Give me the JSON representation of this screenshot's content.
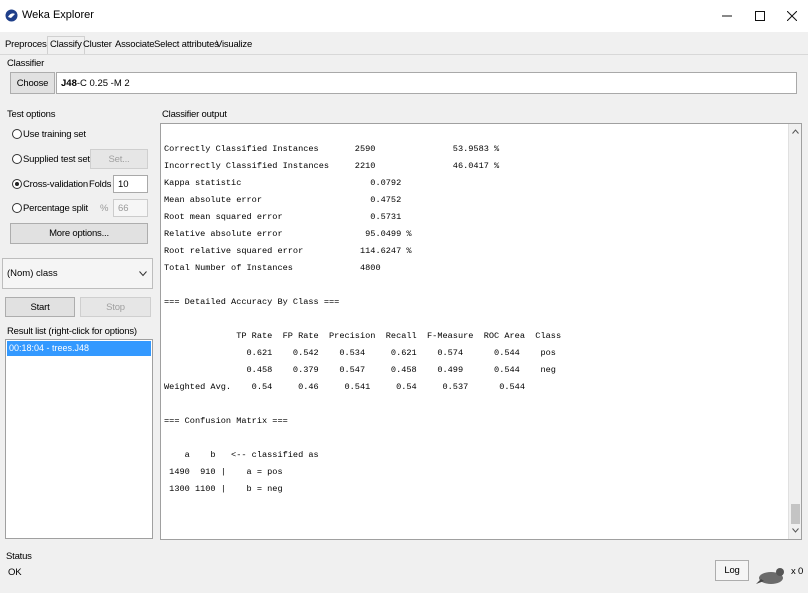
{
  "window": {
    "title": "Weka Explorer"
  },
  "tabs": [
    "Preprocess",
    "Classify",
    "Cluster",
    "Associate",
    "Select attributes",
    "Visualize"
  ],
  "classifier": {
    "section_label": "Classifier",
    "choose_label": "Choose",
    "name": "J48",
    "options": " -C 0.25 -M 2"
  },
  "test_options": {
    "section_label": "Test options",
    "use_training": "Use training set",
    "supplied_test": "Supplied test set",
    "set_button": "Set...",
    "cross_validation": "Cross-validation",
    "folds_label": "Folds",
    "folds_value": "10",
    "percentage_split": "Percentage split",
    "percent_symbol": "%",
    "percent_value": "66",
    "more_options": "More options..."
  },
  "class_select": {
    "value": "(Nom) class"
  },
  "actions": {
    "start": "Start",
    "stop": "Stop"
  },
  "result_list": {
    "label": "Result list (right-click for options)",
    "items": [
      "00:18:04 - trees.J48"
    ]
  },
  "output": {
    "label": "Classifier output",
    "lines": [
      "",
      "Correctly Classified Instances       2590               53.9583 %",
      "Incorrectly Classified Instances     2210               46.0417 %",
      "Kappa statistic                         0.0792",
      "Mean absolute error                     0.4752",
      "Root mean squared error                 0.5731",
      "Relative absolute error                95.0499 %",
      "Root relative squared error           114.6247 %",
      "Total Number of Instances             4800",
      "",
      "=== Detailed Accuracy By Class ===",
      "",
      "              TP Rate  FP Rate  Precision  Recall  F-Measure  ROC Area  Class",
      "                0.621    0.542    0.534     0.621    0.574      0.544    pos",
      "                0.458    0.379    0.547     0.458    0.499      0.544    neg",
      "Weighted Avg.    0.54     0.46     0.541     0.54     0.537      0.544",
      "",
      "=== Confusion Matrix ===",
      "",
      "    a    b   <-- classified as",
      " 1490  910 |    a = pos",
      " 1300 1100 |    b = neg"
    ]
  },
  "status": {
    "label": "Status",
    "text": "OK",
    "log_button": "Log",
    "x_count": "x 0"
  },
  "colors": {
    "selection": "#3399ff",
    "background": "#f0f0f0"
  },
  "icons": {
    "app": "weka-bird-icon",
    "status": "weka-bird-status-icon"
  }
}
